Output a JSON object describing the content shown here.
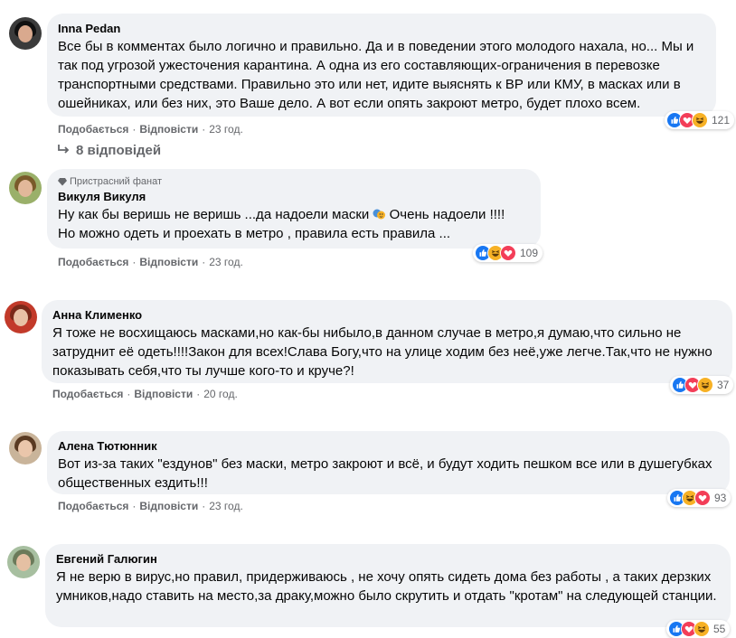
{
  "comments": [
    {
      "author": "Inna Pedan",
      "text": "Все бы в комментах было логично и правильно. Да и в поведении этого молодого нахала, но... Мы и так под угрозой ужесточения карантина. А одна из его составляющих-ограничения в перевозке транспортными средствами. Правильно это или нет, идите выяснять к ВР или КМУ, в масках или в ошейниках, или без них, это Ваше дело. А вот если опять закроют метро, будет плохо всем.",
      "like": "Подобається",
      "reply": "Відповісти",
      "time": "23 год.",
      "reaction_count": "121",
      "replies_label": "8 відповідей"
    },
    {
      "badge": "Пристрасний фанат",
      "author": "Викуля Викуля",
      "text_a": "Ну как бы веришь не веришь ...да надоели маски",
      "text_b": "Очень надоели !!!!",
      "text_c": "Но можно одеть и проехать в метро , правила есть правила ...",
      "like": "Подобається",
      "reply": "Відповісти",
      "time": "23 год.",
      "reaction_count": "109"
    },
    {
      "author": "Анна Клименко",
      "text": "Я тоже не восхищаюсь масками,но как-бы нибыло,в данном случае в метро,я думаю,что сильно не затруднит её одеть!!!!Закон для всех!Слава Богу,что на улице ходим без неё,уже легче.Так,что не нужно показывать себя,что ты лучше кого-то и круче?!",
      "like": "Подобається",
      "reply": "Відповісти",
      "time": "20 год.",
      "reaction_count": "37"
    },
    {
      "author": "Алена Тютюнник",
      "text": "Вот из-за таких \"ездунов\" без маски, метро закроют и всё, и будут ходить пешком все или в душегубках общественных ездить!!!",
      "like": "Подобається",
      "reply": "Відповісти",
      "time": "23 год.",
      "reaction_count": "93"
    },
    {
      "author": "Евгений Галюгин",
      "text": "Я не верю в вирус,но правил, придерживаюсь , не хочу опять сидеть дома без работы , а таких дерзких умников,надо ставить на место,за драку,можно было скрутить и отдать \"кротам\" на следующей станции.",
      "reaction_count": "55"
    }
  ],
  "icons": {
    "like": "like-reaction-icon",
    "love": "love-reaction-icon",
    "haha": "haha-reaction-icon",
    "badge": "diamond-badge-icon",
    "reply_arrow": "reply-arrow-icon",
    "theater": "theater-masks-emoji-icon"
  },
  "colors": {
    "bubble": "#f0f2f5",
    "secondary_text": "#65676b",
    "like_blue": "#1877f2",
    "love_red": "#f33e58",
    "haha_yellow": "#f7b125"
  }
}
